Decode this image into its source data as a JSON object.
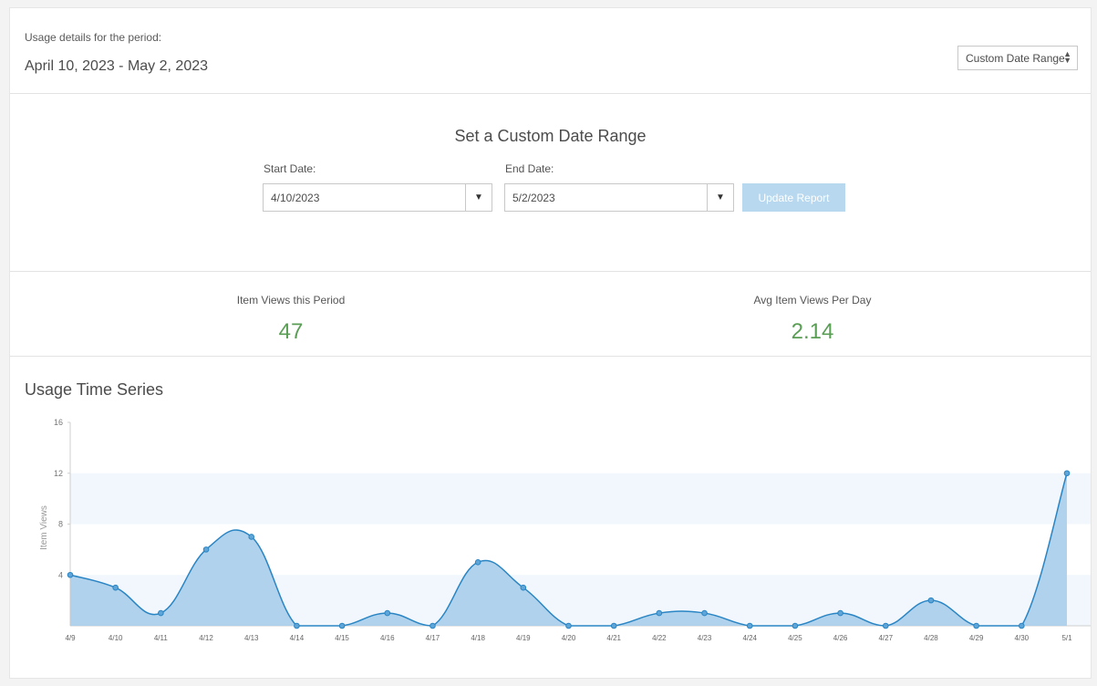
{
  "header": {
    "period_label": "Usage details for the period:",
    "period_value": "April 10, 2023 - May 2, 2023",
    "range_select": "Custom Date Range",
    "range_select_icon": "up-down-arrows-icon"
  },
  "custom_range": {
    "title": "Set a Custom Date Range",
    "start_label": "Start Date:",
    "start_value": "4/10/2023",
    "end_label": "End Date:",
    "end_value": "5/2/2023",
    "dropdown_icon": "caret-down-icon",
    "update_button": "Update Report"
  },
  "stats": {
    "views_label": "Item Views this Period",
    "views_value": "47",
    "avg_label": "Avg Item Views Per Day",
    "avg_value": "2.14",
    "value_color": "#5a9e55"
  },
  "chart_section": {
    "title": "Usage Time Series"
  },
  "chart_data": {
    "type": "area",
    "title": "Usage Time Series",
    "xlabel": "",
    "ylabel": "Item Views",
    "ylim": [
      0,
      16
    ],
    "yticks": [
      4,
      8,
      12,
      16
    ],
    "grid": "alternating bands",
    "categories": [
      "4/9",
      "4/10",
      "4/11",
      "4/12",
      "4/13",
      "4/14",
      "4/15",
      "4/16",
      "4/17",
      "4/18",
      "4/19",
      "4/20",
      "4/21",
      "4/22",
      "4/23",
      "4/24",
      "4/25",
      "4/26",
      "4/27",
      "4/28",
      "4/29",
      "4/30",
      "5/1"
    ],
    "series": [
      {
        "values": [
          4,
          3,
          1,
          6,
          7,
          0,
          0,
          1,
          0,
          5,
          3,
          0,
          0,
          1,
          1,
          0,
          0,
          1,
          0,
          2,
          0,
          0,
          12
        ],
        "color": "#2a85c4",
        "fill": "#a9cdea"
      }
    ]
  }
}
